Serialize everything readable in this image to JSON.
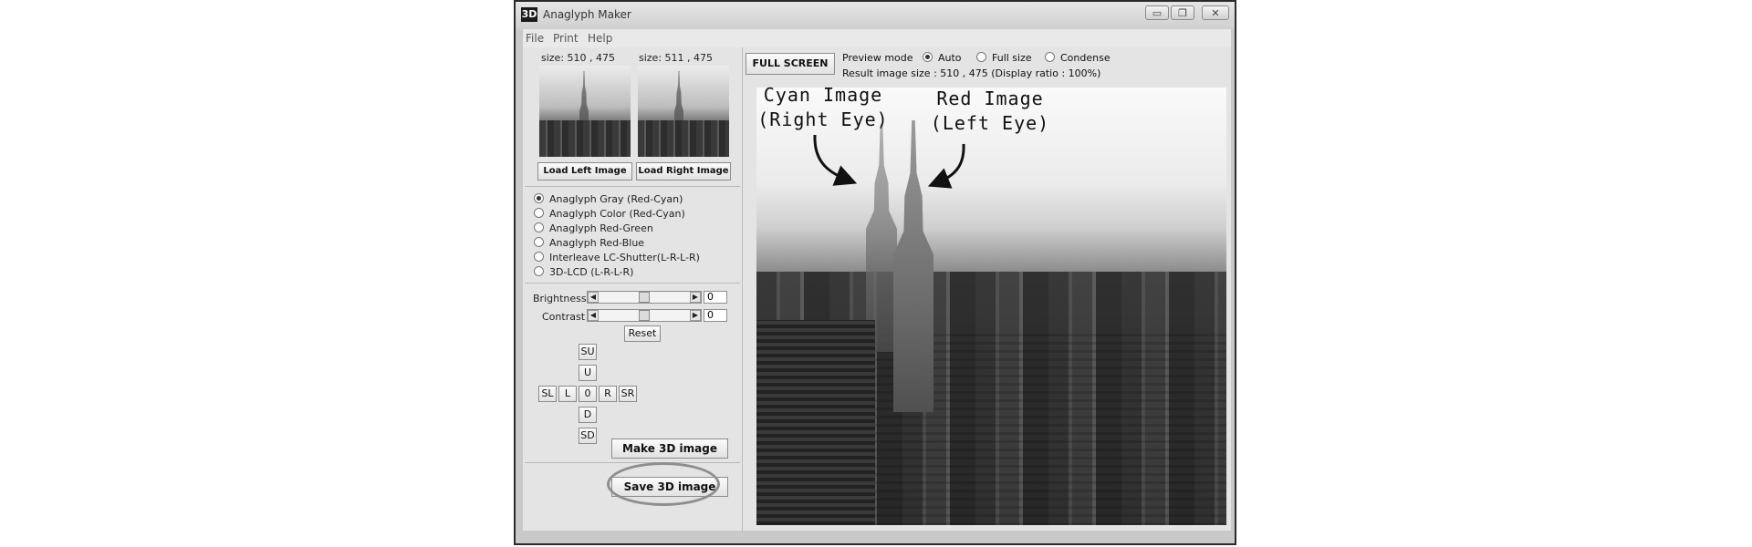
{
  "window": {
    "title": "Anaglyph Maker",
    "icon_text": "3D",
    "controls": {
      "minimize": "▭",
      "restore": "❐",
      "close": "✕"
    }
  },
  "menu": [
    "File",
    "Print",
    "Help"
  ],
  "left_images": {
    "left_size": "size: 510 , 475",
    "right_size": "size: 511 , 475",
    "load_left": "Load Left Image",
    "load_right": "Load Right Image"
  },
  "modes": [
    {
      "label": "Anaglyph Gray (Red-Cyan)",
      "selected": true
    },
    {
      "label": "Anaglyph Color (Red-Cyan)",
      "selected": false
    },
    {
      "label": "Anaglyph Red-Green",
      "selected": false
    },
    {
      "label": "Anaglyph Red-Blue",
      "selected": false
    },
    {
      "label": "Interleave LC-Shutter(L-R-L-R)",
      "selected": false
    },
    {
      "label": "3D-LCD (L-R-L-R)",
      "selected": false
    }
  ],
  "adjust": {
    "brightness_label": "Brightness",
    "brightness_value": "0",
    "brightness_level": 0.5,
    "contrast_label": "Contrast",
    "contrast_value": "0",
    "contrast_level": 0.5,
    "reset": "Reset"
  },
  "nudge": {
    "su": "SU",
    "u": "U",
    "sl": "SL",
    "l": "L",
    "center": "0",
    "r": "R",
    "sr": "SR",
    "d": "D",
    "sd": "SD"
  },
  "make_button": "Make 3D image",
  "save_button": "Save 3D image",
  "preview": {
    "fullscreen": "FULL SCREEN",
    "mode_label": "Preview mode",
    "options": [
      {
        "label": "Auto",
        "selected": true
      },
      {
        "label": "Full size",
        "selected": false
      },
      {
        "label": "Condense",
        "selected": false
      }
    ],
    "result_size": "Result image size :  510 , 475  (Display ratio : 100%)"
  },
  "annotations": {
    "cyan_line1": "Cyan Image",
    "cyan_line2": "(Right Eye)",
    "red_line1": "Red Image",
    "red_line2": "(Left Eye)"
  }
}
